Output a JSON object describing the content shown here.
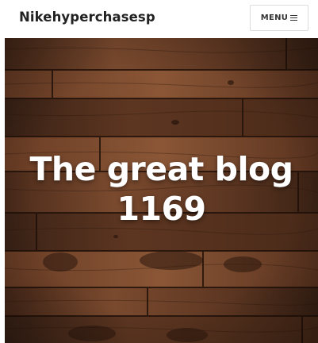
{
  "header": {
    "site_title": "Nikehyperchasesp",
    "menu_label": "MENU"
  },
  "hero": {
    "title": "The great blog 1169"
  },
  "colors": {
    "wood_dark": "#3a2216",
    "wood_mid": "#6b4029",
    "wood_light": "#8a5a3a",
    "title_text": "#ffffff"
  },
  "icons": {
    "menu": "hamburger-icon"
  }
}
